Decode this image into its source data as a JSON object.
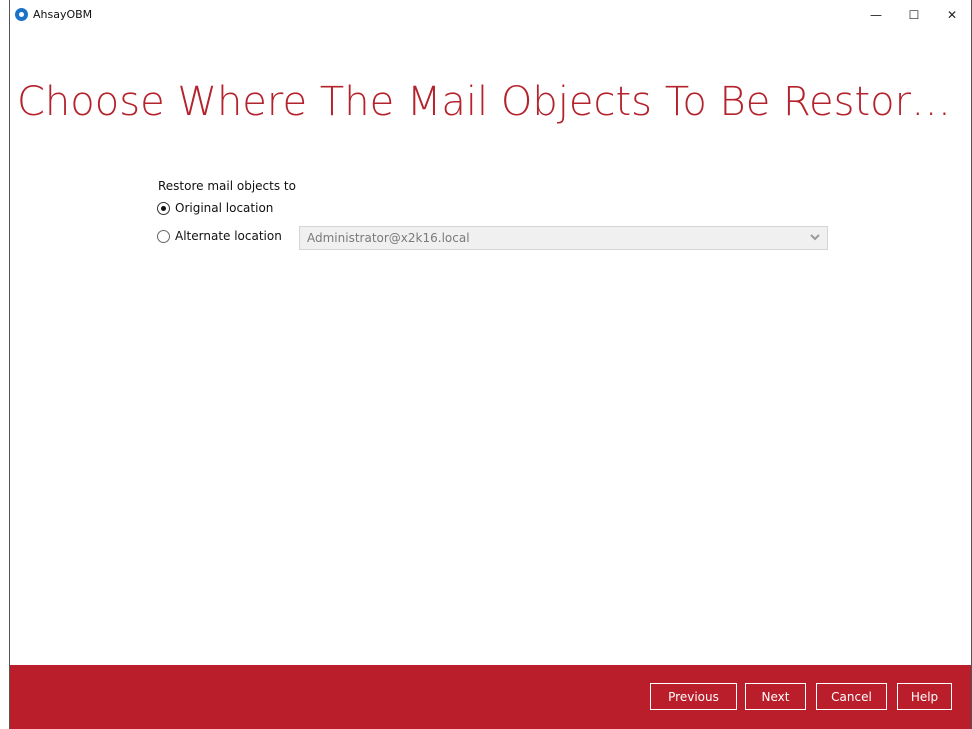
{
  "window": {
    "app_title": "AhsayOBM",
    "minimize_glyph": "—",
    "maximize_glyph": "☐",
    "close_glyph": "✕"
  },
  "page": {
    "title": "Choose Where The Mail Objects To Be Restor…"
  },
  "restore": {
    "label": "Restore mail objects to",
    "options": [
      {
        "label": "Original location",
        "selected": true
      },
      {
        "label": "Alternate location",
        "selected": false
      }
    ],
    "alternate_select_value": "Administrator@x2k16.local"
  },
  "footer": {
    "previous": "Previous",
    "next": "Next",
    "cancel": "Cancel",
    "help": "Help"
  },
  "colors": {
    "accent": "#b91e2a",
    "title": "#b4222c"
  },
  "icons": {
    "app": "app-logo-icon",
    "dropdown": "chevron-down-icon"
  }
}
